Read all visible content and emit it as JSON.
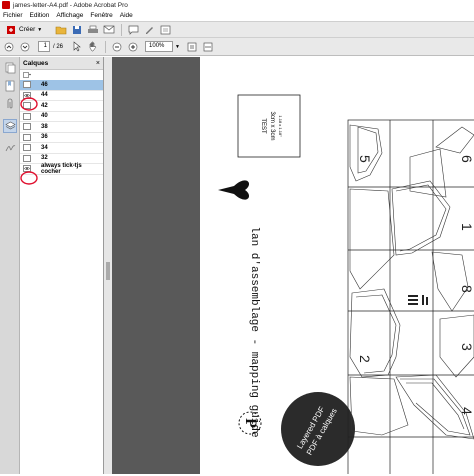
{
  "window": {
    "title": "james-letter-A4.pdf - Adobe Acrobat Pro"
  },
  "menu": [
    "Fichier",
    "Edition",
    "Affichage",
    "Fenêtre",
    "Aide"
  ],
  "toolbar": {
    "create_label": "Créer",
    "page_current": "1",
    "page_total": "/ 26",
    "zoom": "100%"
  },
  "layers_panel": {
    "title": "Calques",
    "close": "×",
    "items": [
      {
        "label": "46",
        "selected": true
      },
      {
        "label": "44",
        "selected": false
      },
      {
        "label": "42",
        "selected": false
      },
      {
        "label": "40",
        "selected": false
      },
      {
        "label": "38",
        "selected": false
      },
      {
        "label": "36",
        "selected": false
      },
      {
        "label": "34",
        "selected": false
      },
      {
        "label": "32",
        "selected": false
      },
      {
        "label": "always tick-tjs cocher",
        "selected": false
      }
    ]
  },
  "document": {
    "stamp_lines": [
      "TEST",
      "3cm x 3cm",
      "1.18 x 1.18\""
    ],
    "vertical_title": "lan d'assemblage - mapping guide",
    "drop_cap": "P",
    "circle_lines": [
      "Layered PDF",
      "PDF à calques"
    ],
    "piece_numbers": [
      "5",
      "6",
      "1",
      "8",
      "2",
      "3",
      "4"
    ],
    "colors": {
      "annotation": "#e0102f",
      "dark_circle": "#2b2b2b",
      "doc_bg": "#595959"
    }
  }
}
